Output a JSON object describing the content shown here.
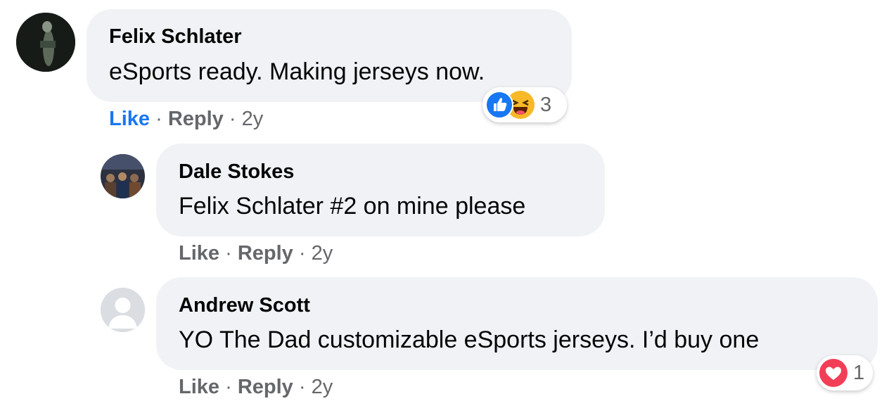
{
  "comments": [
    {
      "author": "Felix Schlater",
      "text": "eSports ready. Making jerseys now.",
      "like_label": "Like",
      "reply_label": "Reply",
      "time": "2y",
      "reaction_count": "3",
      "reaction_icons": [
        "like-icon",
        "haha-icon"
      ],
      "liked": true
    },
    {
      "author": "Dale Stokes",
      "text": "Felix Schlater #2 on mine please",
      "like_label": "Like",
      "reply_label": "Reply",
      "time": "2y"
    },
    {
      "author": "Andrew Scott",
      "text": "YO The Dad customizable eSports jerseys. I’d buy one",
      "like_label": "Like",
      "reply_label": "Reply",
      "time": "2y",
      "reaction_count": "1",
      "reaction_icons": [
        "love-icon"
      ]
    }
  ],
  "separator": "·",
  "colors": {
    "bubble": "#f0f2f5",
    "liked": "#1877f2",
    "secondary_text": "#65676b",
    "love": "#f33e58",
    "haha": "#f7b928"
  }
}
